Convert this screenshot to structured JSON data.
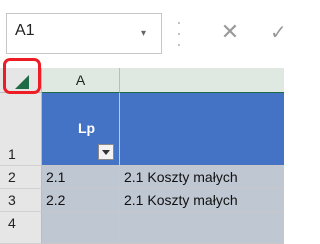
{
  "formula_bar": {
    "name_box": "A1",
    "dropdown_glyph": "▾",
    "cancel_glyph": "✕",
    "enter_glyph": "✓"
  },
  "columns": [
    {
      "label": "A"
    }
  ],
  "rows": [
    {
      "number": "1",
      "lp": "Lp",
      "desc": ""
    },
    {
      "number": "2",
      "lp": "2.1",
      "desc": "2.1 Koszty małych"
    },
    {
      "number": "3",
      "lp": "2.2",
      "desc": "2.1 Koszty małych"
    },
    {
      "number": "4",
      "lp": "",
      "desc": ""
    }
  ],
  "colors": {
    "header_fill": "#4472c4",
    "data_fill": "#bfc7d2",
    "highlight": "#ee1c24",
    "select_all_triangle": "#1e6b45"
  },
  "icons": {
    "select_all": "select-all-triangle-icon",
    "filter": "filter-dropdown-icon",
    "cancel": "cancel-icon",
    "enter": "enter-check-icon"
  }
}
